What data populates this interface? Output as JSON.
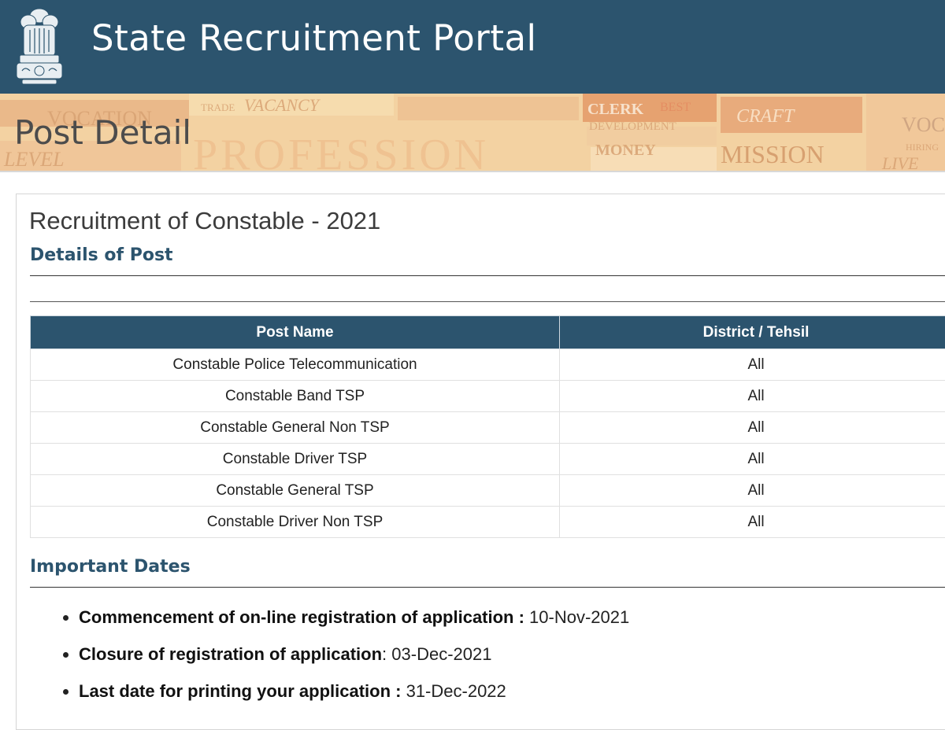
{
  "header": {
    "title": "State Recruitment Portal",
    "emblem_icon": "national-emblem-icon",
    "background": "#2c546e"
  },
  "banner": {
    "heading": "Post Detail",
    "art_words": [
      "VOCATION",
      "TRADE",
      "VACANCY",
      "PROFESSION",
      "CLERK",
      "BEST",
      "DEVELOPMENT",
      "MONEY",
      "CRAFT",
      "MISSION",
      "VOC",
      "LEVEL",
      "HIRING",
      "LIVE"
    ]
  },
  "content": {
    "recruitment_title": "Recruitment of Constable - 2021",
    "details_heading": "Details of Post",
    "table": {
      "headers": [
        "Post Name",
        "District / Tehsil"
      ],
      "rows": [
        [
          "Constable Police Telecommunication",
          "All"
        ],
        [
          "Constable Band TSP",
          "All"
        ],
        [
          "Constable General Non TSP",
          "All"
        ],
        [
          "Constable Driver TSP",
          "All"
        ],
        [
          "Constable General TSP",
          "All"
        ],
        [
          "Constable Driver Non TSP",
          "All"
        ]
      ]
    },
    "dates_heading": "Important Dates",
    "dates": [
      {
        "label": "Commencement of on-line registration of application :",
        "value": " 10-Nov-2021"
      },
      {
        "label": "Closure of registration of application",
        "value": ": 03-Dec-2021"
      },
      {
        "label": "Last date for printing your application :",
        "value": " 31-Dec-2022"
      }
    ]
  },
  "colors": {
    "accent": "#2c546e",
    "banner_bg": "#f3d3a5"
  }
}
